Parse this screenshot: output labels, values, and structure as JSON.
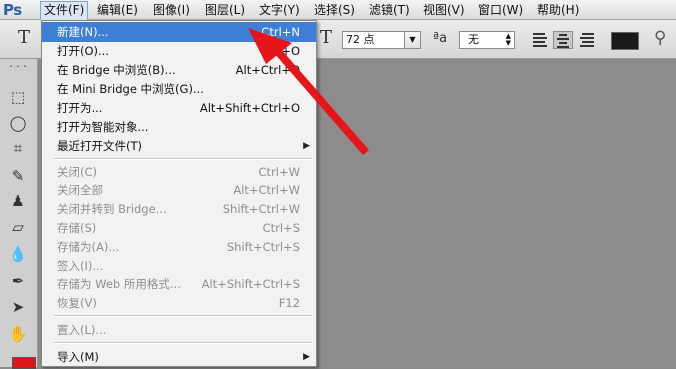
{
  "app": {
    "logo": "Ps"
  },
  "menubar": {
    "items": [
      {
        "label": "文件(F)"
      },
      {
        "label": "编辑(E)"
      },
      {
        "label": "图像(I)"
      },
      {
        "label": "图层(L)"
      },
      {
        "label": "文字(Y)"
      },
      {
        "label": "选择(S)"
      },
      {
        "label": "滤镜(T)"
      },
      {
        "label": "视图(V)"
      },
      {
        "label": "窗口(W)"
      },
      {
        "label": "帮助(H)"
      }
    ]
  },
  "options": {
    "text_tool_glyph": "T",
    "size_value": "72 点",
    "aa_icon": "ªa",
    "aa_value": "无",
    "text_color": "#1a1a1a"
  },
  "file_menu": {
    "items": [
      {
        "label": "新建(N)...",
        "shortcut": "Ctrl+N",
        "state": "highlight"
      },
      {
        "label": "打开(O)...",
        "shortcut": "Ctrl+O",
        "state": "enabled"
      },
      {
        "label": "在 Bridge 中浏览(B)...",
        "shortcut": "Alt+Ctrl+O",
        "state": "enabled"
      },
      {
        "label": "在 Mini Bridge 中浏览(G)...",
        "shortcut": "",
        "state": "enabled"
      },
      {
        "label": "打开为...",
        "shortcut": "Alt+Shift+Ctrl+O",
        "state": "enabled"
      },
      {
        "label": "打开为智能对象...",
        "shortcut": "",
        "state": "enabled"
      },
      {
        "label": "最近打开文件(T)",
        "shortcut": "",
        "state": "enabled",
        "submenu": true
      },
      {
        "label": "关闭(C)",
        "shortcut": "Ctrl+W",
        "state": "disabled"
      },
      {
        "label": "关闭全部",
        "shortcut": "Alt+Ctrl+W",
        "state": "disabled"
      },
      {
        "label": "关闭并转到 Bridge...",
        "shortcut": "Shift+Ctrl+W",
        "state": "disabled"
      },
      {
        "label": "存储(S)",
        "shortcut": "Ctrl+S",
        "state": "disabled"
      },
      {
        "label": "存储为(A)...",
        "shortcut": "Shift+Ctrl+S",
        "state": "disabled"
      },
      {
        "label": "签入(I)...",
        "shortcut": "",
        "state": "disabled"
      },
      {
        "label": "存储为 Web 所用格式...",
        "shortcut": "Alt+Shift+Ctrl+S",
        "state": "disabled"
      },
      {
        "label": "恢复(V)",
        "shortcut": "F12",
        "state": "disabled"
      },
      {
        "label": "置入(L)...",
        "shortcut": "",
        "state": "disabled"
      },
      {
        "label": "导入(M)",
        "shortcut": "",
        "state": "enabled",
        "submenu": true
      }
    ],
    "submenu_glyph": "▶"
  },
  "colors": {
    "highlight": "#3d7fd6",
    "annotation_arrow": "#e8141b",
    "foreground_swatch": "#e0141b"
  }
}
